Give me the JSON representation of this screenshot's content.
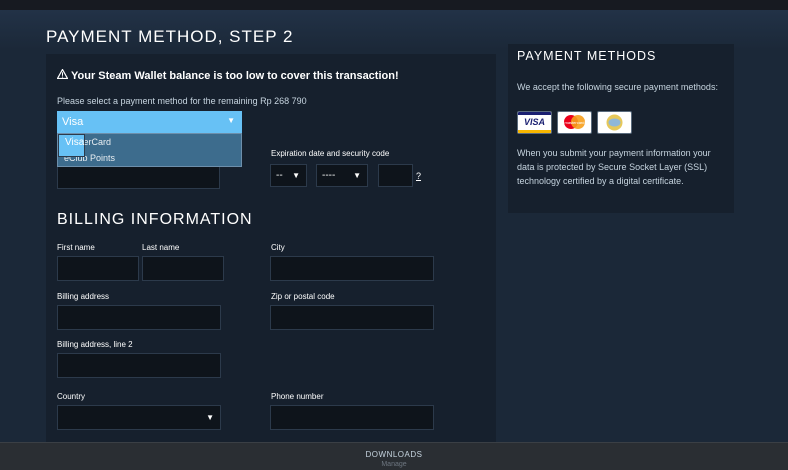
{
  "page_title": "PAYMENT METHOD, STEP 2",
  "warning": {
    "icon": "warning-triangle-icon",
    "text": "Your Steam Wallet balance is too low to cover this transaction!"
  },
  "select_prompt": "Please select a payment method for the remaining Rp 268 790",
  "payment_dropdown": {
    "selected": "Visa",
    "options": [
      "Visa",
      "MasterCard",
      "eClub Points"
    ]
  },
  "expiration": {
    "label": "Expiration date and security code",
    "month": "--",
    "year": "----",
    "help": "?"
  },
  "billing": {
    "title": "BILLING INFORMATION",
    "first_name": "First name",
    "last_name": "Last name",
    "city": "City",
    "address": "Billing address",
    "zip": "Zip or postal code",
    "address2": "Billing address, line 2",
    "country": "Country",
    "phone": "Phone number"
  },
  "side": {
    "title": "PAYMENT METHODS",
    "accept_text": "We accept the following secure payment methods:",
    "visa_label": "VISA",
    "mc_label": "mastercard",
    "security_text": "When you submit your payment information your data is protected by Secure Socket Layer (SSL) technology certified by a digital certificate."
  },
  "bottom": {
    "downloads": "DOWNLOADS",
    "manage": "Manage"
  },
  "colors": {
    "accent": "#67c1f5",
    "background": "#1b2838",
    "panel": "#16202d"
  }
}
